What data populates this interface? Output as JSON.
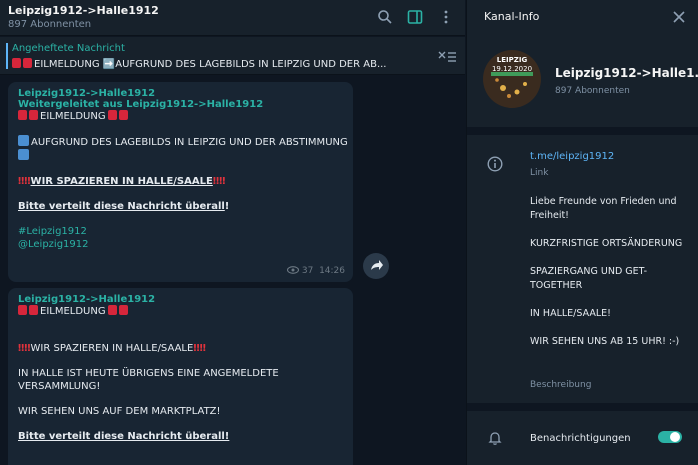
{
  "chat": {
    "title": "Leipzig1912->Halle1912",
    "subscribers": "897 Abonnenten",
    "icons": [
      "search-icon",
      "sidebar-toggle-icon",
      "more-vert-icon"
    ]
  },
  "pinned": {
    "label": "Angeheftete Nachricht",
    "text": "EILMELDUNG ➡️AUFGRUND DES LAGEBILDS IN LEIPZIG UND DER AB..."
  },
  "message1": {
    "sender": "Leipzig1912->Halle1912",
    "forwarded": "Weitergeleitet aus Leipzig1912->Halle1912",
    "line1": "EILMELDUNG",
    "line2": "AUFGRUND DES LAGEBILDS IN LEIPZIG UND DER ABSTIMMUNG",
    "line3": "WIR SPAZIEREN IN HALLE/SAALE",
    "line4": "Bitte verteilt diese Nachricht überall",
    "line4_suffix": "!",
    "hashtag": "#Leipzig1912",
    "mention": "@Leipzig1912",
    "views": "37",
    "time": "14:26"
  },
  "message2": {
    "sender": "Leipzig1912->Halle1912",
    "line1": "EILMELDUNG",
    "line2": "WIR SPAZIEREN IN HALLE/SAALE",
    "line3": "IN HALLE IST HEUTE ÜBRIGENS EINE ANGEMELDETE",
    "line4": "VERSAMMLUNG!",
    "line5": "WIR SEHEN UNS AUF DEM MARKTPLATZ!",
    "line6": "Bitte verteilt diese Nachricht überall!"
  },
  "info": {
    "title": "Kanal-Info",
    "avatar_top": "LEIPZIG",
    "avatar_date": "19.12.2020",
    "channel_name": "Leipzig1912->Halle1...",
    "subscribers": "897 Abonnenten",
    "link": "t.me/leipzig1912",
    "link_label": "Link",
    "desc1": "Liebe Freunde von Frieden und Freiheit!",
    "desc2": "KURZFRISTIGE ORTSÄNDERUNG",
    "desc3": "SPAZIERGANG UND GET-TOGETHER",
    "desc4": "IN HALLE/SAALE!",
    "desc5": "WIR SEHEN UNS AB 15 UHR! :-)",
    "desc_label": "Beschreibung",
    "notifications": "Benachrichtigungen",
    "notifications_on": true
  },
  "colors": {
    "accent": "#2bb2a5",
    "link": "#5eb5f7",
    "bg": "#0e1621",
    "panel": "#17212b",
    "bubble": "#182533"
  }
}
